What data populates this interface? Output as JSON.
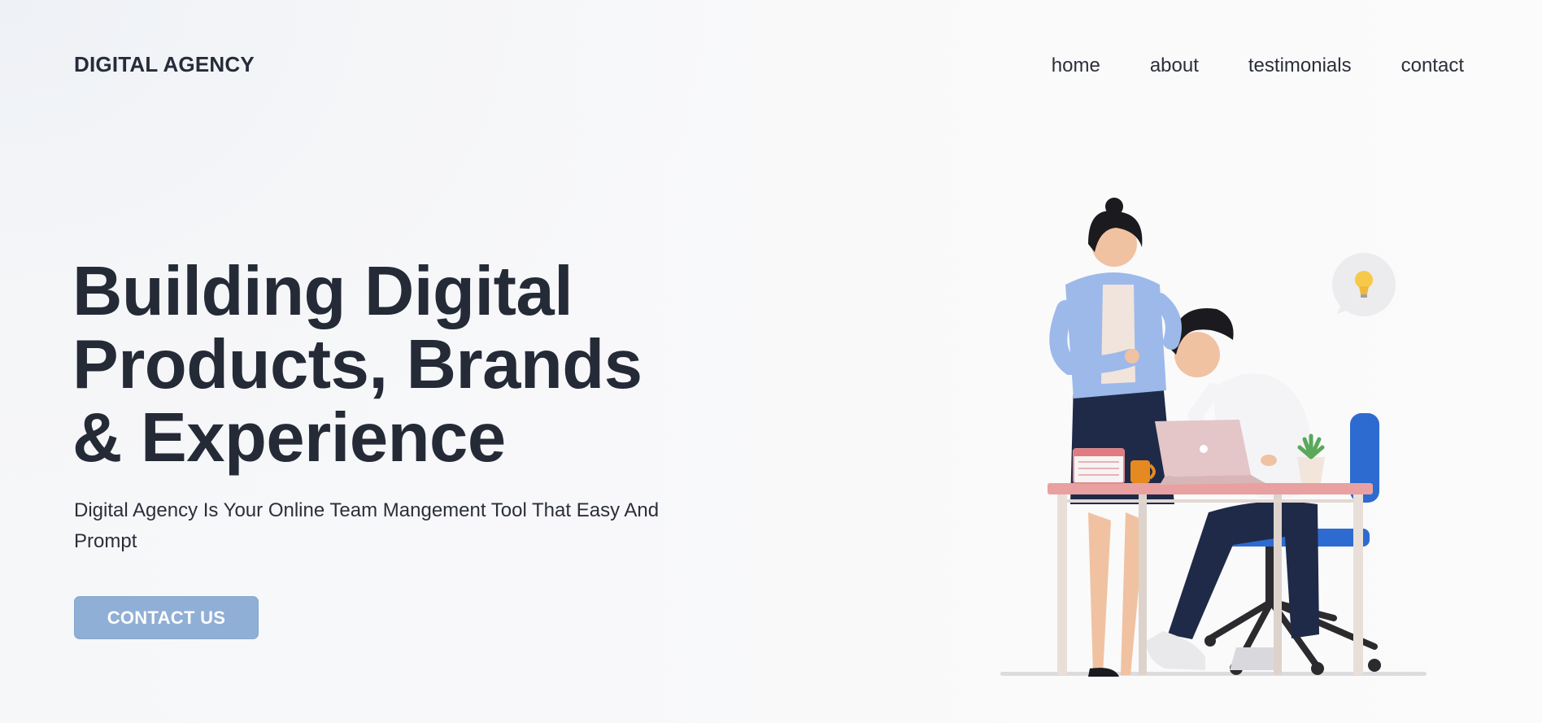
{
  "nav": {
    "logo": "DIGITAL AGENCY",
    "links": [
      "home",
      "about",
      "testimonials",
      "contact"
    ]
  },
  "hero": {
    "title_lines": [
      "Building Digital",
      "Products, Brands",
      "& Experience"
    ],
    "subtitle": "Digital Agency Is Your Online Team Mangement Tool That Easy And Prompt",
    "cta_label": "CONTACT US"
  },
  "colors": {
    "text_dark": "#252a37",
    "cta_background": "#90afd6",
    "cta_text": "#ffffff",
    "page_background": "#f8f9fa"
  },
  "illustration": {
    "description_icon": "office-team-illustration",
    "idea_icon": "lightbulb-icon"
  }
}
